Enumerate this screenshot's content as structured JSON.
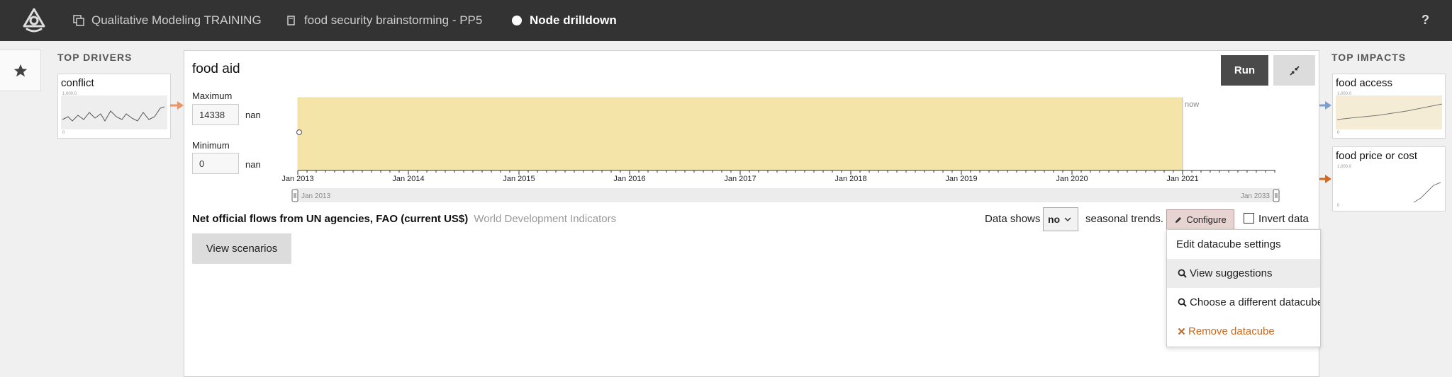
{
  "navbar": {
    "project": "Qualitative Modeling TRAINING",
    "model": "food security brainstorming - PP5",
    "current": "Node drilldown",
    "help": "?"
  },
  "drivers": {
    "title": "TOP DRIVERS",
    "items": [
      {
        "name": "conflict",
        "tick_top": "1,000.0",
        "tick_bottom": "0"
      }
    ]
  },
  "impacts": {
    "title": "TOP IMPACTS",
    "items": [
      {
        "name": "food access",
        "tick_top": "1,000.0",
        "tick_bottom": "0"
      },
      {
        "name": "food price or cost",
        "tick_top": "1,000.0",
        "tick_bottom": "0"
      }
    ]
  },
  "panel": {
    "title": "food aid",
    "run_label": "Run",
    "max_label": "Maximum",
    "max_value": "14338",
    "max_unit": "nan",
    "min_label": "Minimum",
    "min_value": "0",
    "min_unit": "nan",
    "now_label": "now",
    "x_ticks": [
      "Jan 2013",
      "Jan 2014",
      "Jan 2015",
      "Jan 2016",
      "Jan 2017",
      "Jan 2018",
      "Jan 2019",
      "Jan 2020",
      "Jan 2021"
    ],
    "brush_start": "Jan 2013",
    "brush_end": "Jan 2033",
    "indicator_name": "Net official flows from UN agencies, FAO (current US$)",
    "indicator_source": "World Development Indicators",
    "view_scenarios": "View scenarios",
    "data_shows": "Data shows",
    "seasonal_value": "no",
    "seasonal_trends": "seasonal trends.",
    "configure_label": "Configure",
    "invert_label": "Invert data"
  },
  "menu": {
    "items": [
      {
        "label": "Edit datacube settings"
      },
      {
        "label": "View suggestions"
      },
      {
        "label": "Choose a different datacube"
      },
      {
        "label": "Remove datacube"
      }
    ]
  },
  "chart_data": {
    "type": "area",
    "x_domain": [
      "Jan 2013",
      "Jan 2021"
    ],
    "historical_range": [
      "Jan 2013",
      "Jan 2021"
    ],
    "y_range": [
      0,
      14338
    ],
    "highlighted_band_color": "#f5e4a8",
    "colors": {
      "driver_arrow": "#e8956a",
      "impact_blue": "#7a9ecf",
      "impact_orange": "#d46a1a"
    }
  }
}
